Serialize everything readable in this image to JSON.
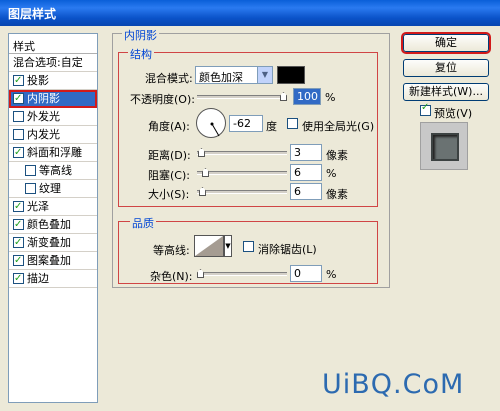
{
  "window": {
    "title": "图层样式"
  },
  "styles_list": {
    "header": "样式",
    "items": [
      {
        "label": "混合选项:自定",
        "checkbox": false,
        "checked": false,
        "indent": false,
        "selected": false
      },
      {
        "label": "投影",
        "checkbox": true,
        "checked": true,
        "indent": false,
        "selected": false
      },
      {
        "label": "内阴影",
        "checkbox": true,
        "checked": true,
        "indent": false,
        "selected": true
      },
      {
        "label": "外发光",
        "checkbox": true,
        "checked": false,
        "indent": false,
        "selected": false
      },
      {
        "label": "内发光",
        "checkbox": true,
        "checked": false,
        "indent": false,
        "selected": false
      },
      {
        "label": "斜面和浮雕",
        "checkbox": true,
        "checked": true,
        "indent": false,
        "selected": false
      },
      {
        "label": "等高线",
        "checkbox": true,
        "checked": false,
        "indent": true,
        "selected": false
      },
      {
        "label": "纹理",
        "checkbox": true,
        "checked": false,
        "indent": true,
        "selected": false
      },
      {
        "label": "光泽",
        "checkbox": true,
        "checked": true,
        "indent": false,
        "selected": false
      },
      {
        "label": "颜色叠加",
        "checkbox": true,
        "checked": true,
        "indent": false,
        "selected": false
      },
      {
        "label": "渐变叠加",
        "checkbox": true,
        "checked": true,
        "indent": false,
        "selected": false
      },
      {
        "label": "图案叠加",
        "checkbox": true,
        "checked": true,
        "indent": false,
        "selected": false
      },
      {
        "label": "描边",
        "checkbox": true,
        "checked": true,
        "indent": false,
        "selected": false
      }
    ]
  },
  "inner_shadow": {
    "group_title": "内阴影",
    "structure_title": "结构",
    "blend_mode_label": "混合模式:",
    "blend_mode_value": "颜色加深",
    "blend_color": "#000000",
    "opacity_label": "不透明度(O):",
    "opacity_value": "100",
    "opacity_unit": "%",
    "opacity_fraction": 1.0,
    "angle_label": "角度(A):",
    "angle_value": "-62",
    "angle_unit": "度",
    "global_light_label": "使用全局光(G)",
    "global_light_checked": false,
    "distance_label": "距离(D):",
    "distance_value": "3",
    "distance_unit": "像素",
    "distance_fraction": 0.012,
    "choke_label": "阻塞(C):",
    "choke_value": "6",
    "choke_unit": "%",
    "choke_fraction": 0.06,
    "size_label": "大小(S):",
    "size_value": "6",
    "size_unit": "像素",
    "size_fraction": 0.024
  },
  "quality": {
    "title": "品质",
    "contour_label": "等高线:",
    "anti_alias_label": "消除锯齿(L)",
    "anti_alias_checked": false,
    "noise_label": "杂色(N):",
    "noise_value": "0",
    "noise_unit": "%",
    "noise_fraction": 0.0
  },
  "buttons": {
    "ok": "确定",
    "reset": "复位",
    "new_style": "新建样式(W)...",
    "preview_label": "预览(V)",
    "preview_checked": true
  },
  "watermark": "UiBQ.CoM"
}
